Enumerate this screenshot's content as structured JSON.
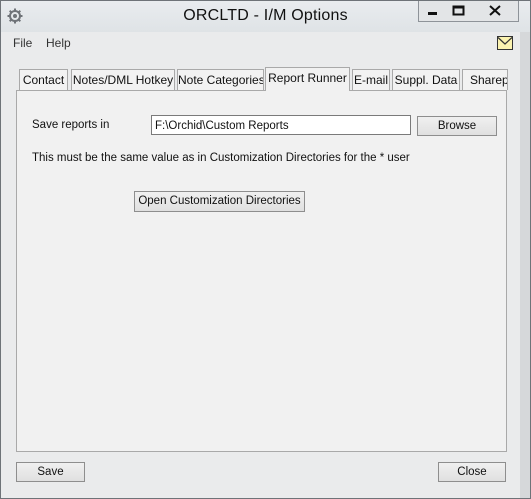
{
  "window": {
    "title": "ORCLTD - I/M Options"
  },
  "menu": {
    "file": "File",
    "help": "Help"
  },
  "tabs": [
    {
      "label": "Contact"
    },
    {
      "label": "Notes/DML Hotkey"
    },
    {
      "label": "Note Categories"
    },
    {
      "label": "Report Runner",
      "active": true
    },
    {
      "label": "E-mail"
    },
    {
      "label": "Suppl. Data"
    },
    {
      "label": "Sharepo"
    }
  ],
  "report_runner": {
    "save_reports_label": "Save reports in",
    "save_reports_value": "F:\\Orchid\\Custom Reports",
    "browse_label": "Browse",
    "note_text": "This must be the same value as in Customization Directories for the * user",
    "open_dirs_label": "Open Customization Directories"
  },
  "footer": {
    "save_label": "Save",
    "close_label": "Close"
  },
  "icons": {
    "app": "gear-icon",
    "mail": "mail-icon"
  }
}
